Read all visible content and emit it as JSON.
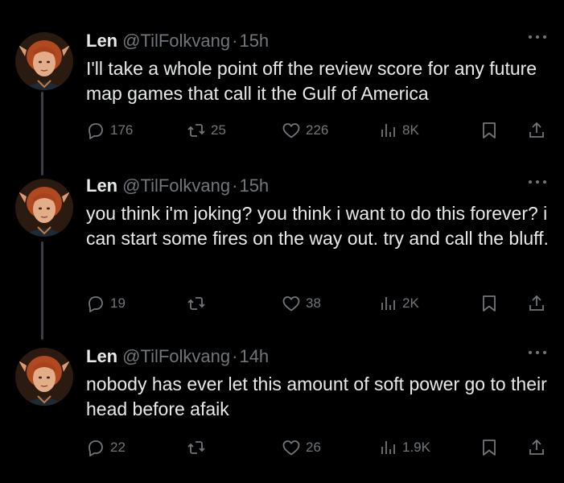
{
  "colors": {
    "background": "#000000",
    "text_primary": "#e7e9ea",
    "text_secondary": "#71767b",
    "thread_line": "#3a3d41"
  },
  "icons": {
    "reply": "reply-icon",
    "retweet": "retweet-icon",
    "like": "heart-icon",
    "views": "views-icon",
    "bookmark": "bookmark-icon",
    "share": "share-icon",
    "more": "more-icon"
  },
  "tweets": [
    {
      "name": "Len",
      "handle": "@TilFolkvang",
      "dot": "·",
      "time": "15h",
      "text": "I'll take a whole point off the review score for any future map games that call it the Gulf of America",
      "replies": "176",
      "retweets": "25",
      "likes": "226",
      "views": "8K"
    },
    {
      "name": "Len",
      "handle": "@TilFolkvang",
      "dot": "·",
      "time": "15h",
      "text": "you think i'm joking? you think i want to do this forever? i can start some fires on the way out. try and call the bluff.",
      "replies": "19",
      "retweets": "",
      "likes": "38",
      "views": "2K"
    },
    {
      "name": "Len",
      "handle": "@TilFolkvang",
      "dot": "·",
      "time": "14h",
      "text": "nobody has ever let this amount of soft power go to their head before afaik",
      "replies": "22",
      "retweets": "",
      "likes": "26",
      "views": "1.9K"
    }
  ]
}
